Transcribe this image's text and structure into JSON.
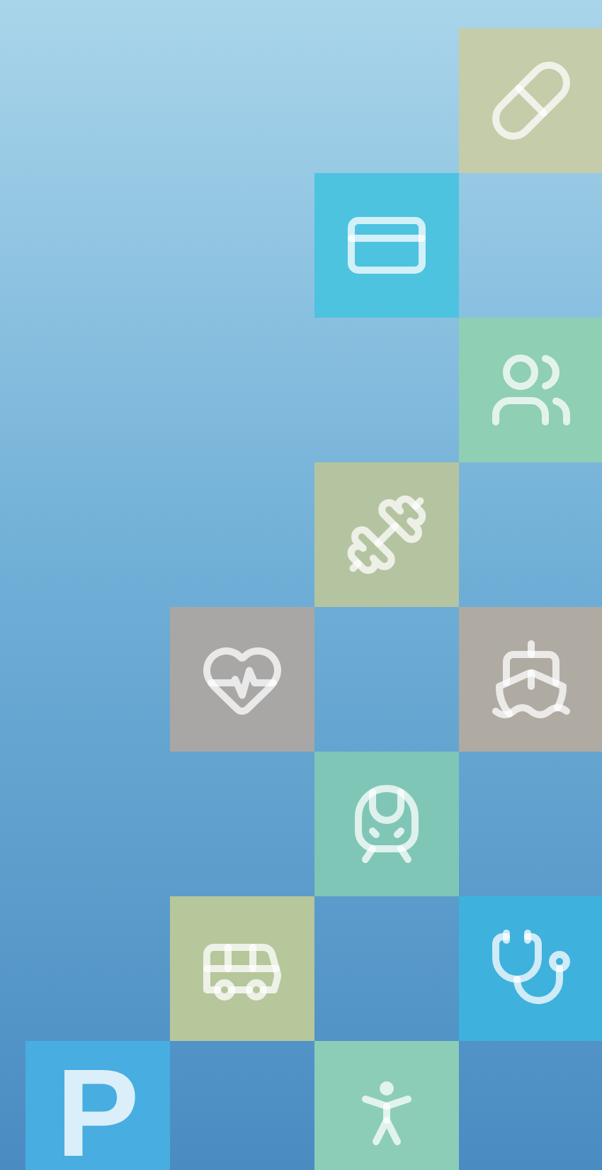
{
  "tiles": [
    {
      "kind": "pill",
      "color": "#c4cca9"
    },
    {
      "kind": "cards",
      "color": "#4ec3e0"
    },
    {
      "kind": "people",
      "color": "#8fcfb4"
    },
    {
      "kind": "dumbbell",
      "color": "#b5c4a0"
    },
    {
      "kind": "heart",
      "color": "#a9a7a6"
    },
    {
      "kind": "ship",
      "color": "#afaba3"
    },
    {
      "kind": "train",
      "color": "#80c6b7"
    },
    {
      "kind": "van",
      "color": "#b6c79c"
    },
    {
      "kind": "stethoscope",
      "color": "#3fb1dd"
    },
    {
      "kind": "letter",
      "color": "#48ade0",
      "label": "P"
    },
    {
      "kind": "yoga",
      "color": "#8ccdb8"
    }
  ]
}
